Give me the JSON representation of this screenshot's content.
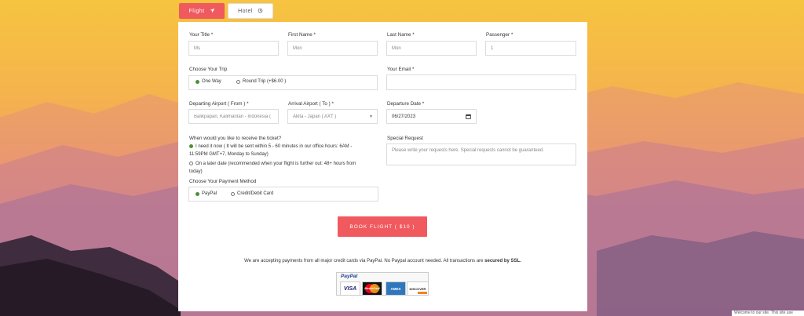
{
  "tabs": [
    {
      "label": "Flight",
      "icon": "plane-icon",
      "active": true
    },
    {
      "label": "Hotel",
      "icon": "hotel-icon",
      "active": false
    }
  ],
  "form": {
    "title_label": "Your Title *",
    "title_value": "Ms",
    "first_name_label": "First Name *",
    "first_name_value": "Mon",
    "last_name_label": "Last Name *",
    "last_name_value": "Mon",
    "passenger_label": "Passenger *",
    "passenger_value": "1",
    "trip_label": "Choose Your Trip",
    "trip_options": [
      {
        "label": "One Way",
        "selected": true
      },
      {
        "label": "Round Trip (+$6.00 )",
        "selected": false
      }
    ],
    "email_label": "Your Email *",
    "email_value": "",
    "depart_label": "Departing Airport ( From ) *",
    "depart_value": "Balikpapan, Kalimantan - Indonesia ( ...",
    "arrival_label": "Arrival Airport ( To ) *",
    "arrival_value": "Akita - Japan ( AXT )",
    "date_label": "Departure Date *",
    "date_value": "06/27/2023",
    "ticket_label": "When would you like to receive the ticket?",
    "ticket_options": [
      {
        "lines": [
          "I need it now ( It will be sent within 5 - 60 minutes in our office hours: 6AM -",
          "11:59PM GMT+7, Monday to Sunday)"
        ],
        "selected": true
      },
      {
        "lines": [
          "On a later date (recommended when your flight is further out: 48+ hours from",
          "today)"
        ],
        "selected": false
      }
    ],
    "special_label": "Special Request",
    "special_placeholder": "Please write your requests here. Special requests cannot be guaranteed.",
    "payment_label": "Choose Your Payment Method",
    "payment_options": [
      {
        "label": "PayPal",
        "selected": true
      },
      {
        "label": "Credit/Debit Card",
        "selected": false
      }
    ],
    "book_button": "BOOK FLIGHT ( $10 )"
  },
  "footer": {
    "note_text": "We are accepting payments from all major credit cards via PayPal. No Paypal account needed. All transactions are",
    "note_bold": "secured by SSL.",
    "paypal_label": "PayPal",
    "cards": [
      "VISA",
      "MasterCard",
      "AMEX",
      "DISCOVER"
    ]
  },
  "cookie_text": "Welcome to our site. This site use",
  "colors": {
    "accent": "#f0595e",
    "radio_on": "#4e8f3a"
  }
}
